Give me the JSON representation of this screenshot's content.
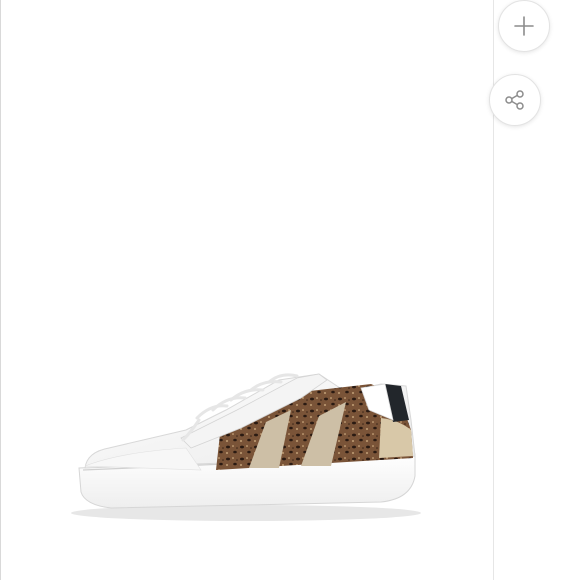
{
  "main_image": {
    "product": "sneaker"
  },
  "actions": {
    "add_icon": "plus-icon",
    "share_icon": "share-icon"
  },
  "colors": {
    "icon": "#8c8c8c",
    "leopard_base": "#6b4a32",
    "stripe": "#cdbfa6",
    "heel_tab": "#22262b"
  }
}
